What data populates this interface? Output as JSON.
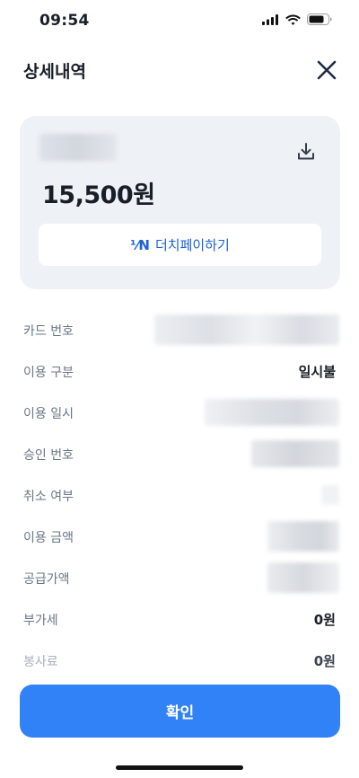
{
  "status_bar": {
    "time": "09:54",
    "icons": [
      "cellular-signal-icon",
      "wifi-icon",
      "battery-icon"
    ]
  },
  "header": {
    "title": "상세내역",
    "close_icon": "close-icon"
  },
  "summary_card": {
    "amount": "15,500원",
    "download_icon": "download-icon",
    "dutch_pay": {
      "icon_text": "⅟N",
      "label": "더치페이하기"
    }
  },
  "details": {
    "rows": [
      {
        "label": "카드 번호",
        "value": ""
      },
      {
        "label": "이용 구분",
        "value": "일시불"
      },
      {
        "label": "이용 일시",
        "value": ""
      },
      {
        "label": "승인 번호",
        "value": ""
      },
      {
        "label": "취소 여부",
        "value": ""
      },
      {
        "label": "이용 금액",
        "value": ""
      },
      {
        "label": "공급가액",
        "value": ""
      },
      {
        "label": "부가세",
        "value": "0원"
      },
      {
        "label": "봉사료",
        "value": "0원"
      }
    ]
  },
  "footer": {
    "confirm_label": "확인"
  },
  "colors": {
    "accent": "#3182f6",
    "link": "#1c62d6",
    "card_bg": "#eef1f6",
    "label_gray": "#6b7684"
  }
}
